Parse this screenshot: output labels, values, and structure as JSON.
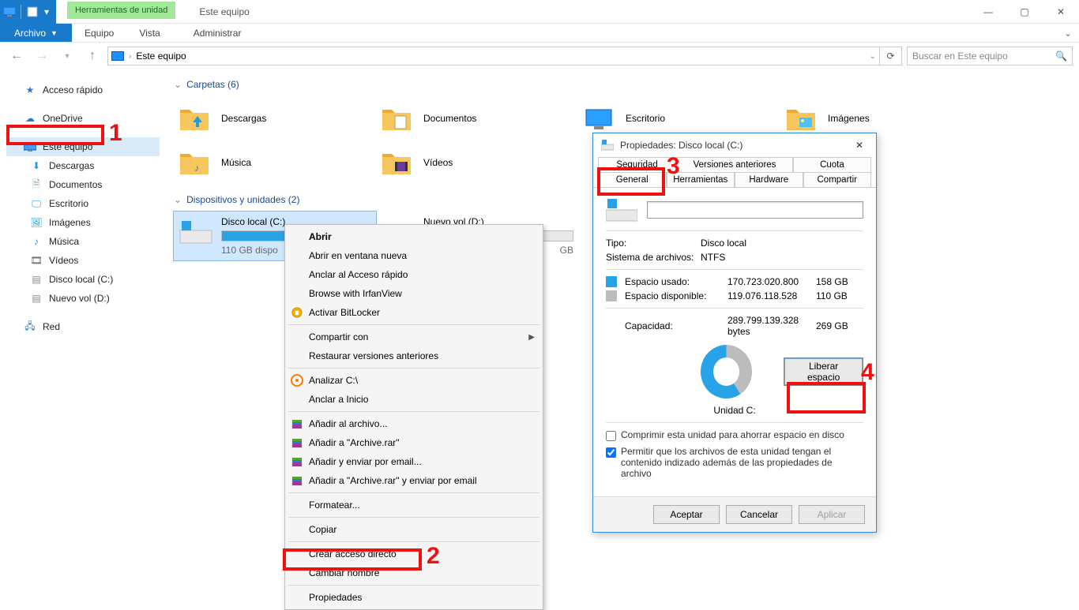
{
  "titlebar": {
    "title": "Este equipo",
    "tools_tab": "Herramientas de unidad"
  },
  "ribbon": {
    "file": "Archivo",
    "tabs": [
      "Equipo",
      "Vista"
    ],
    "manage": "Administrar"
  },
  "address": {
    "path": "Este equipo"
  },
  "search": {
    "placeholder": "Buscar en Este equipo"
  },
  "sidebar": {
    "quick": "Acceso rápido",
    "onedrive": "OneDrive",
    "thispc": "Este equipo",
    "children": [
      "Descargas",
      "Documentos",
      "Escritorio",
      "Imágenes",
      "Música",
      "Vídeos",
      "Disco local (C:)",
      "Nuevo vol (D:)"
    ],
    "network": "Red"
  },
  "sections": {
    "folders": {
      "title": "Carpetas (6)",
      "items": [
        "Descargas",
        "Documentos",
        "Escritorio",
        "Imágenes",
        "Música",
        "Vídeos"
      ]
    },
    "drives": {
      "title": "Dispositivos y unidades (2)",
      "items": [
        {
          "name": "Disco local (C:)",
          "free": "110 GB dispo",
          "fill": 58
        },
        {
          "name": "Nuevo vol (D:)",
          "free": "GB",
          "fill": 5
        }
      ]
    }
  },
  "context_menu": {
    "items": [
      {
        "label": "Abrir",
        "bold": true
      },
      {
        "label": "Abrir en ventana nueva"
      },
      {
        "label": "Anclar al Acceso rápido"
      },
      {
        "label": "Browse with IrfanView"
      },
      {
        "label": "Activar BitLocker",
        "icon": "bitlocker"
      },
      {
        "sep": true
      },
      {
        "label": "Compartir con",
        "sub": true
      },
      {
        "label": "Restaurar versiones anteriores"
      },
      {
        "sep": true
      },
      {
        "label": "Analizar C:\\",
        "icon": "avast"
      },
      {
        "label": "Anclar a Inicio"
      },
      {
        "sep": true
      },
      {
        "label": "Añadir al archivo...",
        "icon": "rar"
      },
      {
        "label": "Añadir a \"Archive.rar\"",
        "icon": "rar"
      },
      {
        "label": "Añadir y enviar por email...",
        "icon": "rar"
      },
      {
        "label": "Añadir a \"Archive.rar\" y enviar por email",
        "icon": "rar"
      },
      {
        "sep": true
      },
      {
        "label": "Formatear..."
      },
      {
        "sep": true
      },
      {
        "label": "Copiar"
      },
      {
        "sep": true
      },
      {
        "label": "Crear acceso directo"
      },
      {
        "label": "Cambiar nombre"
      },
      {
        "sep": true
      },
      {
        "label": "Propiedades",
        "hl": true
      }
    ]
  },
  "properties": {
    "title": "Propiedades: Disco local (C:)",
    "tabs_row1": [
      "Seguridad",
      "Versiones anteriores",
      "Cuota"
    ],
    "tabs_row2": [
      "General",
      "Herramientas",
      "Hardware",
      "Compartir"
    ],
    "type_label": "Tipo:",
    "type_value": "Disco local",
    "fs_label": "Sistema de archivos:",
    "fs_value": "NTFS",
    "used_label": "Espacio usado:",
    "used_bytes": "170.723.020.800",
    "used_gb": "158 GB",
    "free_label": "Espacio disponible:",
    "free_bytes": "119.076.118.528",
    "free_gb": "110 GB",
    "cap_label": "Capacidad:",
    "cap_bytes": "289.799.139.328 bytes",
    "cap_gb": "269 GB",
    "unit_label": "Unidad C:",
    "free_space_btn": "Liberar espacio",
    "compress": "Comprimir esta unidad para ahorrar espacio en disco",
    "index": "Permitir que los archivos de esta unidad tengan el contenido indizado además de las propiedades de archivo",
    "ok": "Aceptar",
    "cancel": "Cancelar",
    "apply": "Aplicar"
  },
  "annotations": {
    "n1": "1",
    "n2": "2",
    "n3": "3",
    "n4": "4"
  }
}
